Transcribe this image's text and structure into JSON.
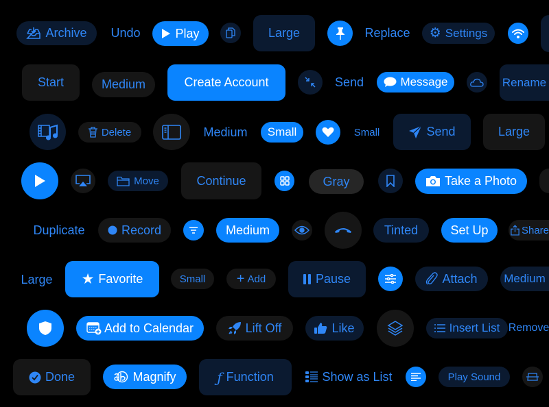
{
  "colors": {
    "accent": "#0a84ff",
    "tinted_bg": "#0b1a30",
    "gray_bg": "#161616",
    "background": "#000000"
  },
  "buttons": {
    "archive": {
      "label": "Archive",
      "icon": "tray-arrow-down-icon"
    },
    "undo": {
      "label": "Undo"
    },
    "play": {
      "label": "Play",
      "icon": "play-icon"
    },
    "copy": {
      "icon": "doc-on-doc-icon"
    },
    "large1": {
      "label": "Large"
    },
    "pin": {
      "icon": "pin-icon"
    },
    "replace": {
      "label": "Replace"
    },
    "settings": {
      "label": "Settings",
      "icon": "gear-icon"
    },
    "wifi": {
      "icon": "wifi-icon"
    },
    "start": {
      "label": "Start"
    },
    "medium1": {
      "label": "Medium"
    },
    "create_account": {
      "label": "Create Account"
    },
    "compress": {
      "icon": "arrows-in-icon"
    },
    "send1": {
      "label": "Send"
    },
    "message": {
      "label": "Message",
      "icon": "message-bubble-icon"
    },
    "cloud": {
      "icon": "cloud-icon"
    },
    "rename": {
      "label": "Rename"
    },
    "film_music": {
      "icon": "film-music-icon"
    },
    "delete": {
      "label": "Delete",
      "icon": "trash-icon"
    },
    "sidebar": {
      "icon": "sidebar-icon"
    },
    "medium2": {
      "label": "Medium"
    },
    "small1": {
      "label": "Small"
    },
    "heart": {
      "icon": "heart-icon"
    },
    "small2": {
      "label": "Small"
    },
    "send2": {
      "label": "Send",
      "icon": "paperplane-icon"
    },
    "large2": {
      "label": "Large"
    },
    "play_circle": {
      "icon": "play-icon"
    },
    "airplay": {
      "icon": "airplay-icon"
    },
    "move": {
      "label": "Move",
      "icon": "folder-icon"
    },
    "continue": {
      "label": "Continue"
    },
    "grid": {
      "icon": "grid-icon"
    },
    "gray": {
      "label": "Gray"
    },
    "bookmark": {
      "icon": "bookmark-icon"
    },
    "take_photo": {
      "label": "Take a Photo",
      "icon": "camera-icon"
    },
    "duplicate": {
      "label": "Duplicate"
    },
    "record": {
      "label": "Record",
      "icon": "record-dot-icon"
    },
    "filter": {
      "icon": "filter-lines-icon"
    },
    "medium3": {
      "label": "Medium"
    },
    "eye": {
      "icon": "eye-icon"
    },
    "hangup": {
      "icon": "phone-down-icon"
    },
    "tinted": {
      "label": "Tinted"
    },
    "setup": {
      "label": "Set Up"
    },
    "share": {
      "label": "Share",
      "icon": "share-icon"
    },
    "large3": {
      "label": "Large"
    },
    "favorite": {
      "label": "Favorite",
      "icon": "star-icon"
    },
    "small3": {
      "label": "Small"
    },
    "add": {
      "label": "Add",
      "icon": "plus-icon"
    },
    "pause": {
      "label": "Pause",
      "icon": "pause-icon"
    },
    "sliders": {
      "icon": "sliders-icon"
    },
    "attach": {
      "label": "Attach",
      "icon": "paperclip-icon"
    },
    "medium4": {
      "label": "Medium"
    },
    "shield": {
      "icon": "shield-icon"
    },
    "add_calendar": {
      "label": "Add to Calendar",
      "icon": "calendar-plus-icon"
    },
    "lift_off": {
      "label": "Lift Off",
      "icon": "rocket-icon"
    },
    "like": {
      "label": "Like",
      "icon": "thumbs-up-icon"
    },
    "layers": {
      "icon": "layers-icon"
    },
    "insert_list": {
      "label": "Insert List",
      "icon": "list-icon"
    },
    "remove": {
      "label": "Remove"
    },
    "done": {
      "label": "Done",
      "icon": "checkmark-circle-icon"
    },
    "magnify": {
      "label": "Magnify",
      "icon": "magnify-text-icon"
    },
    "function": {
      "label": "Function",
      "icon": "function-icon"
    },
    "show_list": {
      "label": "Show as List",
      "icon": "list-bullet-icon"
    },
    "align": {
      "icon": "text-align-left-icon"
    },
    "play_sound": {
      "label": "Play Sound"
    },
    "perspective": {
      "icon": "perspective-icon"
    }
  }
}
